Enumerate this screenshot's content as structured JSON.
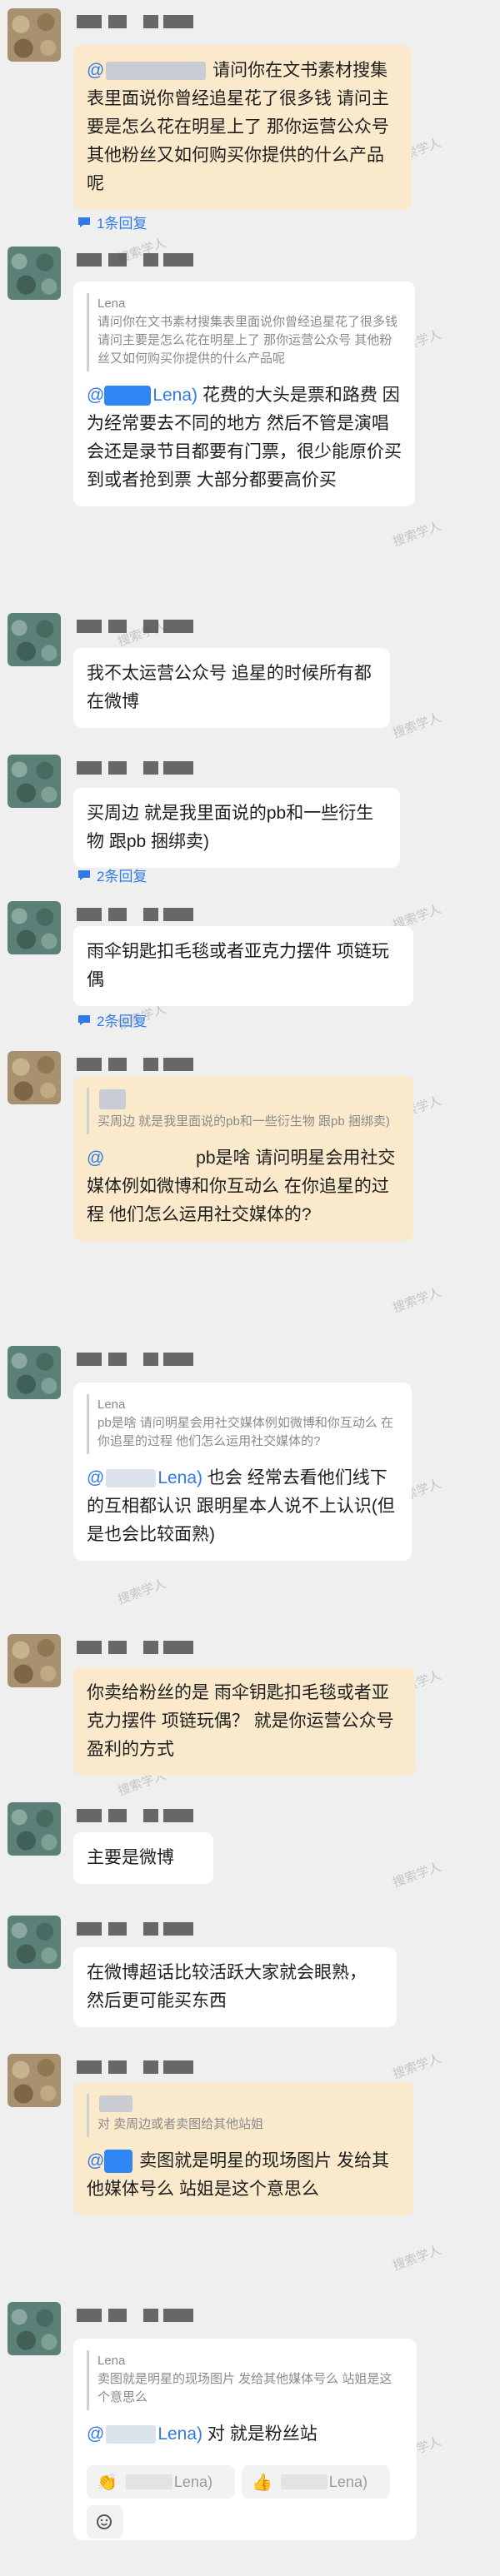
{
  "watermark": "搜索学人",
  "messages": [
    {
      "id": "m1",
      "bubble": {
        "mention": "@",
        "text": "请问你在文书素材搜集表里面说你曾经追星花了很多钱 请问主要是怎么花在明星上了 那你运营公众号 其他粉丝又如何购买你提供的什么产品呢"
      },
      "replies": "1条回复"
    },
    {
      "id": "m2",
      "quote": {
        "author": "Lena",
        "text": "请问你在文书素材搜集表里面说你曾经追星花了很多钱 请问主要是怎么花在明星上了 那你运营公众号 其他粉丝又如何购买你提供的什么产品呢"
      },
      "bubble": {
        "mention": "@",
        "mention_end": "Lena)",
        "text": "花费的大头是票和路费 因为经常要去不同的地方 然后不管是演唱会还是录节目都要有门票，很少能原价买到或者抢到票 大部分都要高价买"
      }
    },
    {
      "id": "m3",
      "bubble": {
        "text": "我不太运营公众号 追星的时候所有都在微博"
      }
    },
    {
      "id": "m4",
      "bubble": {
        "text": "买周边 就是我里面说的pb和一些衍生物 跟pb 捆绑卖)"
      },
      "replies": "2条回复"
    },
    {
      "id": "m5",
      "bubble": {
        "text": "雨伞钥匙扣毛毯或者亚克力摆件 项链玩偶"
      },
      "replies": "2条回复"
    },
    {
      "id": "m6",
      "quote": {
        "text": "买周边 就是我里面说的pb和一些衍生物 跟pb 捆绑卖)"
      },
      "bubble": {
        "mention": "@",
        "text": "pb是啥 请问明星会用社交媒体例如微博和你互动么 在你追星的过程 他们怎么运用社交媒体的?"
      }
    },
    {
      "id": "m7",
      "quote": {
        "author": "Lena",
        "text": "pb是啥 请问明星会用社交媒体例如微博和你互动么 在你追星的过程 他们怎么运用社交媒体的?"
      },
      "bubble": {
        "mention": "@",
        "mention_end": "Lena)",
        "text": "也会 经常去看他们线下的互相都认识 跟明星本人说不上认识(但是也会比较面熟)"
      }
    },
    {
      "id": "m8",
      "bubble": {
        "text": "你卖给粉丝的是 雨伞钥匙扣毛毯或者亚克力摆件 项链玩偶？ 就是你运营公众号盈利的方式"
      }
    },
    {
      "id": "m9",
      "bubble": {
        "text": "主要是微博"
      }
    },
    {
      "id": "m10",
      "bubble": {
        "text": "在微博超话比较活跃大家就会眼熟，然后更可能买东西"
      }
    },
    {
      "id": "m11",
      "quote": {
        "text": "对 卖周边或者卖图给其他站姐"
      },
      "bubble": {
        "mention": "@",
        "text": "卖图就是明星的现场图片 发给其他媒体号么 站姐是这个意思么"
      }
    },
    {
      "id": "m12",
      "quote": {
        "author": "Lena",
        "text": "卖图就是明星的现场图片 发给其他媒体号么 站姐是这个意思么"
      },
      "bubble": {
        "mention": "@",
        "mention_end": "Lena)",
        "text": "对 就是粉丝站"
      },
      "reactions": [
        {
          "icon": "clap",
          "label": "Lena)"
        },
        {
          "icon": "thumbs-up",
          "label": "Lena)"
        }
      ],
      "reaction_button": "add-reaction"
    }
  ]
}
